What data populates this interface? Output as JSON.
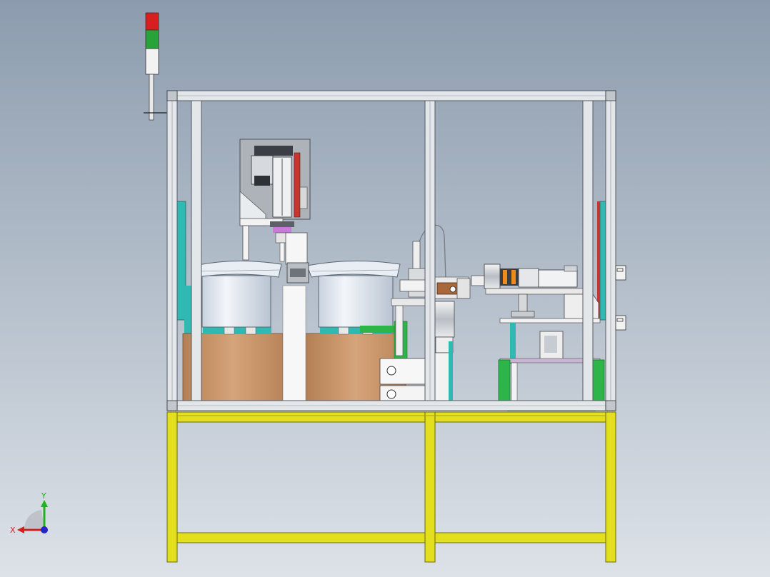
{
  "viewport": {
    "background_top": "#8c9cae",
    "background_bottom": "#dde2e8"
  },
  "colors": {
    "frame_profile": "#e4e7ea",
    "frame_edge": "#555b62",
    "table_yellow": "#e3df1e",
    "table_edge": "#6b6a10",
    "bowl_steel": "#dfe6ef",
    "box_tan": "#c9956a",
    "accent_teal": "#2fb9b2",
    "accent_green": "#2db54a",
    "accent_red": "#c8342e",
    "accent_orange": "#f08a1c",
    "stack_light_red": "#d71f1f",
    "stack_light_green": "#27a338",
    "stack_light_white": "#f2f2f2",
    "panel_gray": "#aeb3ba",
    "plate_white": "#f7f7f7"
  },
  "stack_light": {
    "segments": [
      "red",
      "green",
      "white"
    ]
  },
  "triad": {
    "x_label": "X",
    "y_label": "Y",
    "x_color": "#d21e1e",
    "y_color": "#21b121",
    "z_color": "#2424c9"
  }
}
